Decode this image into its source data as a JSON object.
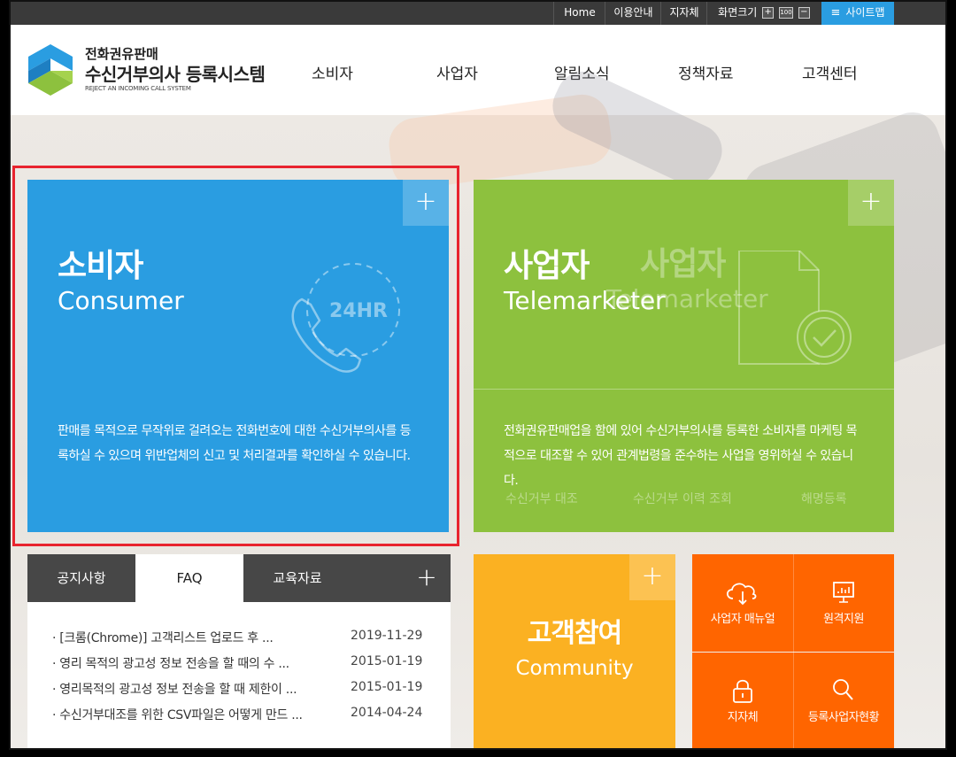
{
  "utility_bar": {
    "home": "Home",
    "guide": "이용안내",
    "local_gov": "지자체",
    "screen_size": "화면크기",
    "zoom_in": "+",
    "zoom_reset": "100",
    "zoom_out": "−",
    "sitemap": "사이트맵"
  },
  "header": {
    "logo_line1": "전화권유판매",
    "logo_line2": "수신거부의사 등록시스템",
    "logo_line3": "REJECT AN INCOMING CALL SYSTEM",
    "nav": [
      "소비자",
      "사업자",
      "알림소식",
      "정책자료",
      "고객센터"
    ]
  },
  "consumer_tile": {
    "plus": "+",
    "title_ko": "소비자",
    "title_en": "Consumer",
    "badge": "24HR",
    "description": "판매를 목적으로 무작위로 걸려오는 전화번호에 대한 수신거부의사를 등록하실 수 있으며 위반업체의 신고 및 처리결과를 확인하실 수 있습니다."
  },
  "business_tile": {
    "plus": "+",
    "title_ko": "사업자",
    "title_en": "Telemarketer",
    "ghost_title_ko": "사업자",
    "ghost_title_en": "Telemarketer",
    "description": "전화권유판매업을 함에 있어 수신거부의사를 등록한 소비자를 마케팅 목적으로 대조할 수 있어 관계법령을 준수하는 사업을 영위하실 수 있습니다.",
    "ghost_links": [
      "수신거부 대조",
      "수신거부 이력 조회",
      "해명등록"
    ]
  },
  "tabs": {
    "items": [
      "공지사항",
      "FAQ",
      "교육자료"
    ],
    "active_index": 1,
    "plus": "+",
    "faq_list": [
      {
        "title": "· [크롬(Chrome)] 고객리스트 업로드 후 ...",
        "date": "2019-11-29"
      },
      {
        "title": "· 영리 목적의 광고성 정보 전송을 할 때의 수 ...",
        "date": "2015-01-19"
      },
      {
        "title": "· 영리목적의 광고성 정보 전송을 할 때 제한이 ...",
        "date": "2015-01-19"
      },
      {
        "title": "· 수신거부대조를 위한 CSV파일은 어떻게 만드 ...",
        "date": "2014-04-24"
      }
    ]
  },
  "community": {
    "plus": "+",
    "title_ko": "고객참여",
    "title_en": "Community"
  },
  "quick_links": [
    {
      "label": "사업자 매뉴얼",
      "icon": "cloud-download-icon"
    },
    {
      "label": "원격지원",
      "icon": "monitor-icon"
    },
    {
      "label": "지자체",
      "icon": "lock-icon"
    },
    {
      "label": "등록사업자현황",
      "icon": "search-icon"
    }
  ],
  "colors": {
    "consumer_blue": "#2a9de1",
    "business_green": "#8dc13e",
    "community_yellow": "#fbb122",
    "quick_orange": "#ff6500",
    "tab_dark": "#474747",
    "highlight_red": "#e8242f"
  }
}
